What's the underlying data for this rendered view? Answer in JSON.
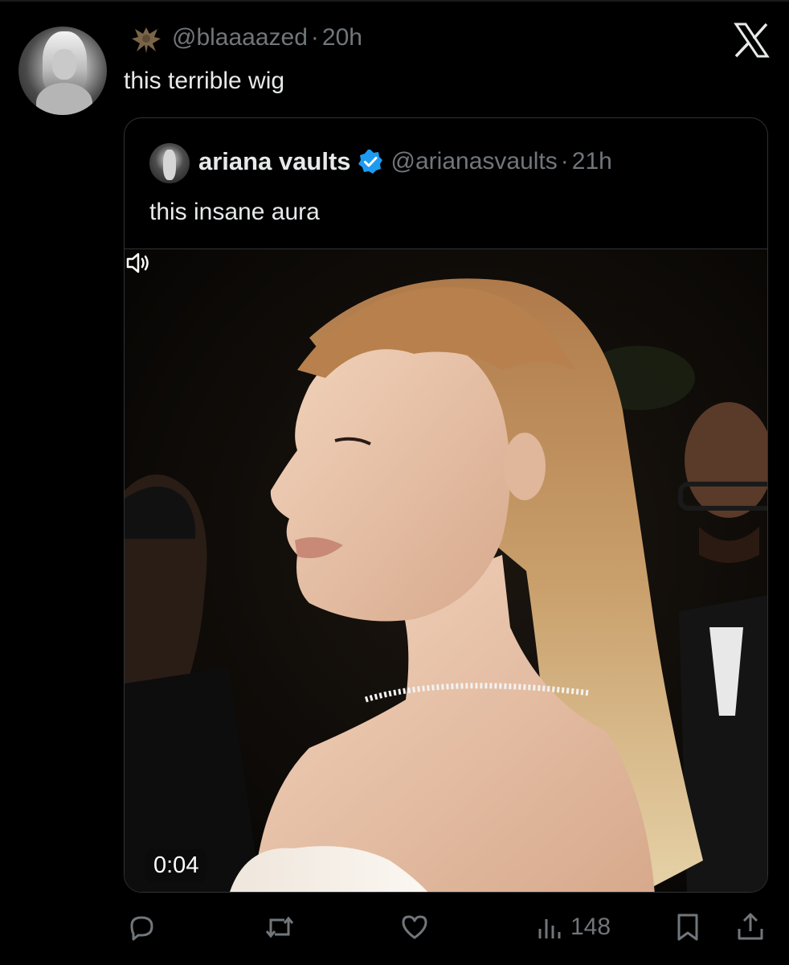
{
  "tweet": {
    "handle": "@blaaaazed",
    "separator": "·",
    "time": "20h",
    "text": "this terrible wig"
  },
  "quoted": {
    "name": "ariana vaults",
    "handle": "@arianasvaults",
    "separator": "·",
    "time": "21h",
    "text": "this insane aura",
    "video_time": "0:04"
  },
  "actions": {
    "views": "148"
  },
  "icons": {
    "header": [
      "bat-icon",
      "x-logo-icon",
      "verified-badge-icon"
    ],
    "media": [
      "volume-icon"
    ],
    "action_bar": [
      "reply-icon",
      "retweet-icon",
      "like-icon",
      "views-icon",
      "bookmark-icon",
      "share-icon"
    ]
  },
  "colors": {
    "background": "#000000",
    "text": "#e7e9ea",
    "muted": "#71767b",
    "border": "#2f3336",
    "verified": "#1d9bf0"
  }
}
